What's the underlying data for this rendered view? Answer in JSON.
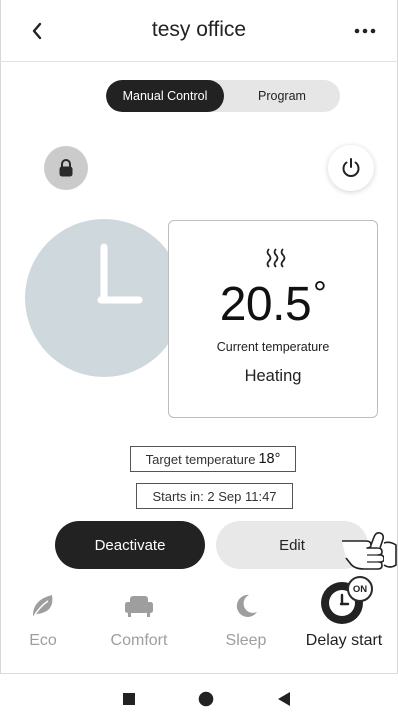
{
  "header": {
    "title": "tesy office",
    "back_icon": "chevron-left-icon",
    "more_icon": "more-dots-icon"
  },
  "mode_switch": {
    "options": [
      "Manual Control",
      "Program"
    ],
    "selected": "Manual Control"
  },
  "controls": {
    "lock_icon": "lock-icon",
    "power_icon": "power-icon"
  },
  "status_card": {
    "heat_icon": "heat-waves-icon",
    "temperature": "20.5",
    "unit": "°",
    "label": "Current temperature",
    "state": "Heating"
  },
  "target": {
    "label": "Target temperature",
    "value": "18°"
  },
  "schedule": {
    "starts_text": "Starts in: 2 Sep 11:47"
  },
  "actions": {
    "deactivate_label": "Deactivate",
    "edit_label": "Edit"
  },
  "modes": {
    "items": [
      {
        "label": "Eco",
        "icon": "leaf-icon",
        "active": false
      },
      {
        "label": "Comfort",
        "icon": "armchair-icon",
        "active": false
      },
      {
        "label": "Sleep",
        "icon": "moon-icon",
        "active": false
      },
      {
        "label": "Delay start",
        "icon": "clock-icon",
        "active": true
      }
    ],
    "delay_badge": "ON"
  },
  "navbar": {
    "icons": [
      "nav-recents-icon",
      "nav-home-icon",
      "nav-back-icon"
    ]
  },
  "colors": {
    "dark": "#222222",
    "dial": "#cfd8dc",
    "inactive_text": "#9e9e9e",
    "pill_bg": "#e8e8e8"
  }
}
